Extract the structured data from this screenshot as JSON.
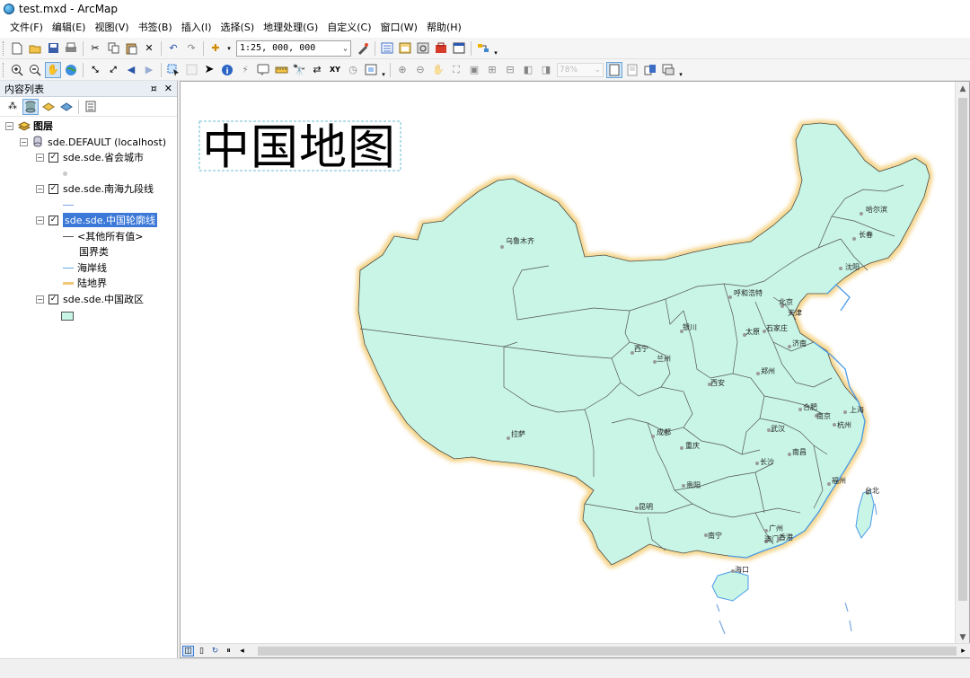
{
  "window": {
    "title": "test.mxd - ArcMap"
  },
  "menu": [
    "文件(F)",
    "编辑(E)",
    "视图(V)",
    "书签(B)",
    "插入(I)",
    "选择(S)",
    "地理处理(G)",
    "自定义(C)",
    "窗口(W)",
    "帮助(H)"
  ],
  "toolbar": {
    "scale_value": "1:25, 000, 000",
    "layout_zoom": "78%"
  },
  "toc": {
    "title": "内容列表",
    "pin_label": "¤",
    "close_label": "✕",
    "root": "图层",
    "database": "sde.DEFAULT (localhost)",
    "layers": [
      {
        "name": "sde.sde.省会城市",
        "checked": true,
        "selected": false
      },
      {
        "name": "sde.sde.南海九段线",
        "checked": true,
        "selected": false
      },
      {
        "name": "sde.sde.中国轮廓线",
        "checked": true,
        "selected": true,
        "legend": [
          "<其他所有值>",
          "国界类",
          "海岸线",
          "陆地界"
        ]
      },
      {
        "name": "sde.sde.中国政区",
        "checked": true,
        "selected": false
      }
    ]
  },
  "map": {
    "title": "中国地图",
    "colors": {
      "land": "#c8f5e6",
      "border_glow": "#f5d58c",
      "coast": "#4a9be8",
      "boundary": "#555555",
      "city_dot": "#999999"
    },
    "cities": [
      "乌鲁木齐",
      "哈尔滨",
      "长春",
      "沈阳",
      "呼和浩特",
      "北京",
      "天津",
      "石家庄",
      "银川",
      "太原",
      "济南",
      "西宁",
      "兰州",
      "郑州",
      "西安",
      "合肥",
      "南京",
      "上海",
      "杭州",
      "武汉",
      "拉萨",
      "成都",
      "重庆",
      "南昌",
      "长沙",
      "福州",
      "台北",
      "贵阳",
      "昆明",
      "南宁",
      "广州",
      "澳门",
      "香港",
      "海口"
    ]
  }
}
